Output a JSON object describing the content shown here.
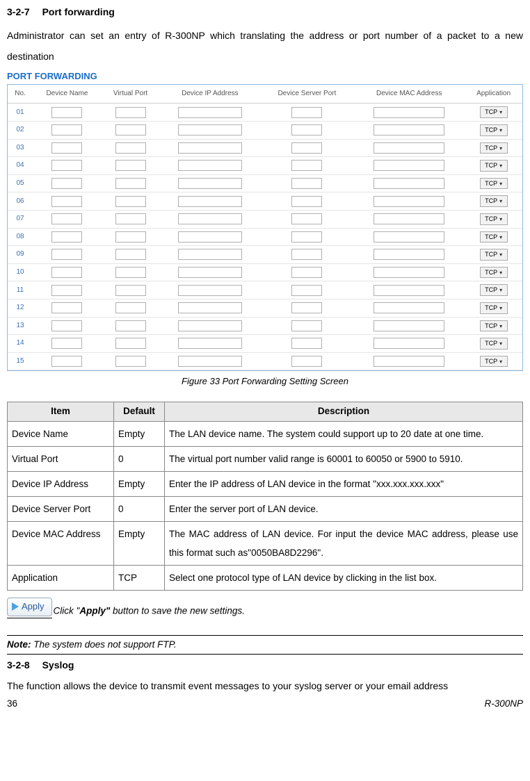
{
  "heading1": {
    "num": "3-2-7",
    "title": "Port forwarding"
  },
  "intro": "Administrator can set an entry of R-300NP which translating the address or port number of a packet to a new destination",
  "pf": {
    "title": "PORT FORWARDING",
    "headers": [
      "No.",
      "Device Name",
      "Virtual Port",
      "Device IP Address",
      "Device Server Port",
      "Device MAC Address",
      "Application"
    ],
    "rows": [
      "01",
      "02",
      "03",
      "04",
      "05",
      "06",
      "07",
      "08",
      "09",
      "10",
      "11",
      "12",
      "13",
      "14",
      "15"
    ],
    "app": "TCP"
  },
  "caption": "Figure 33 Port Forwarding Setting Screen",
  "desc": {
    "headers": [
      "Item",
      "Default",
      "Description"
    ],
    "rows": [
      {
        "item": "Device Name",
        "def": "Empty",
        "text": "The LAN device name. The system could support up to 20 date at one time."
      },
      {
        "item": "Virtual Port",
        "def": "0",
        "text": "The virtual port number valid range is 60001 to 60050 or 5900 to 5910."
      },
      {
        "item": "Device IP Address",
        "def": "Empty",
        "text": "Enter the IP address of LAN device in the format \"xxx.xxx.xxx.xxx\""
      },
      {
        "item": "Device Server Port",
        "def": "0",
        "text": "Enter the server port of LAN device."
      },
      {
        "item": "Device MAC Address",
        "def": "Empty",
        "text": "The MAC address of LAN device. For input the device MAC address, please use this format such as\"0050BA8D2296\"."
      },
      {
        "item": "Application",
        "def": "TCP",
        "text": "Select one protocol type of LAN device by clicking in the list box."
      }
    ]
  },
  "apply": {
    "btn": "Apply",
    "before": "Click \"",
    "bold": "Apply\"",
    "after": " button to save the new settings."
  },
  "note": {
    "label": "Note:",
    "text": " The system does not support FTP."
  },
  "heading2": {
    "num": "3-2-8",
    "title": "Syslog"
  },
  "syslog_body": "The function allows the device to transmit event messages to your syslog server or your email address",
  "footer": {
    "page": "36",
    "model": "R-300NP"
  }
}
